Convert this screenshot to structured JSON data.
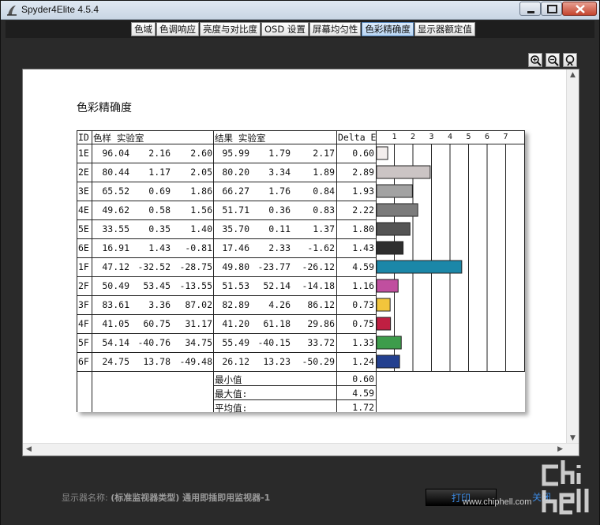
{
  "window": {
    "title": "Spyder4Elite 4.5.4"
  },
  "tabs": [
    {
      "label": "色域",
      "active": false
    },
    {
      "label": "色调响应",
      "active": false
    },
    {
      "label": "亮度与对比度",
      "active": false
    },
    {
      "label": "OSD 设置",
      "active": false
    },
    {
      "label": "屏幕均匀性",
      "active": false
    },
    {
      "label": "色彩精确度",
      "active": true
    },
    {
      "label": "显示器额定值",
      "active": false
    }
  ],
  "toolbar": {
    "zoom_in_icon": "zoom-in-icon",
    "zoom_out_icon": "zoom-out-icon",
    "zoom_fit_icon": "zoom-fit-icon"
  },
  "report": {
    "title": "色彩精确度",
    "headers": {
      "id": "ID",
      "sample": "色样 实验室",
      "result": "结果 实验室",
      "delta": "Delta E",
      "scale": [
        "1",
        "2",
        "3",
        "4",
        "5",
        "6",
        "7"
      ]
    },
    "rows": [
      {
        "id": "1E",
        "s1": "96.04",
        "s2": "2.16",
        "s3": "2.60",
        "r1": "95.99",
        "r2": "1.79",
        "r3": "2.17",
        "de": "0.60",
        "color": "#f3eeed"
      },
      {
        "id": "2E",
        "s1": "80.44",
        "s2": "1.17",
        "s3": "2.05",
        "r1": "80.20",
        "r2": "3.34",
        "r3": "1.89",
        "de": "2.89",
        "color": "#cbc4c4"
      },
      {
        "id": "3E",
        "s1": "65.52",
        "s2": "0.69",
        "s3": "1.86",
        "r1": "66.27",
        "r2": "1.76",
        "r3": "0.84",
        "de": "1.93",
        "color": "#a2a2a2"
      },
      {
        "id": "4E",
        "s1": "49.62",
        "s2": "0.58",
        "s3": "1.56",
        "r1": "51.71",
        "r2": "0.36",
        "r3": "0.83",
        "de": "2.22",
        "color": "#7b7b7b"
      },
      {
        "id": "5E",
        "s1": "33.55",
        "s2": "0.35",
        "s3": "1.40",
        "r1": "35.70",
        "r2": "0.11",
        "r3": "1.37",
        "de": "1.80",
        "color": "#545454"
      },
      {
        "id": "6E",
        "s1": "16.91",
        "s2": "1.43",
        "s3": "-0.81",
        "r1": "17.46",
        "r2": "2.33",
        "r3": "-1.62",
        "de": "1.43",
        "color": "#2e2e2e"
      },
      {
        "id": "1F",
        "s1": "47.12",
        "s2": "-32.52",
        "s3": "-28.75",
        "r1": "49.80",
        "r2": "-23.77",
        "r3": "-26.12",
        "de": "4.59",
        "color": "#1b87a8"
      },
      {
        "id": "2F",
        "s1": "50.49",
        "s2": "53.45",
        "s3": "-13.55",
        "r1": "51.53",
        "r2": "52.14",
        "r3": "-14.18",
        "de": "1.16",
        "color": "#c04f9f"
      },
      {
        "id": "3F",
        "s1": "83.61",
        "s2": "3.36",
        "s3": "87.02",
        "r1": "82.89",
        "r2": "4.26",
        "r3": "86.12",
        "de": "0.73",
        "color": "#f2c53c"
      },
      {
        "id": "4F",
        "s1": "41.05",
        "s2": "60.75",
        "s3": "31.17",
        "r1": "41.20",
        "r2": "61.18",
        "r3": "29.86",
        "de": "0.75",
        "color": "#c01f42"
      },
      {
        "id": "5F",
        "s1": "54.14",
        "s2": "-40.76",
        "s3": "34.75",
        "r1": "55.49",
        "r2": "-40.15",
        "r3": "33.72",
        "de": "1.33",
        "color": "#3d9c4b"
      },
      {
        "id": "6F",
        "s1": "24.75",
        "s2": "13.78",
        "s3": "-49.48",
        "r1": "26.12",
        "r2": "13.23",
        "r3": "-50.29",
        "de": "1.24",
        "color": "#23408f"
      }
    ],
    "summary": [
      {
        "label": "最小值",
        "value": "0.60"
      },
      {
        "label": "最大值:",
        "value": "4.59"
      },
      {
        "label": "平均值:",
        "value": "1.72"
      }
    ]
  },
  "footer": {
    "monitor_label": "显示器名称:",
    "monitor_value": "(标准监视器类型) 通用即插即用监视器-1",
    "print_label": "打印",
    "close_label": "关闭",
    "watermark_url": "www.chiphell.com"
  }
}
